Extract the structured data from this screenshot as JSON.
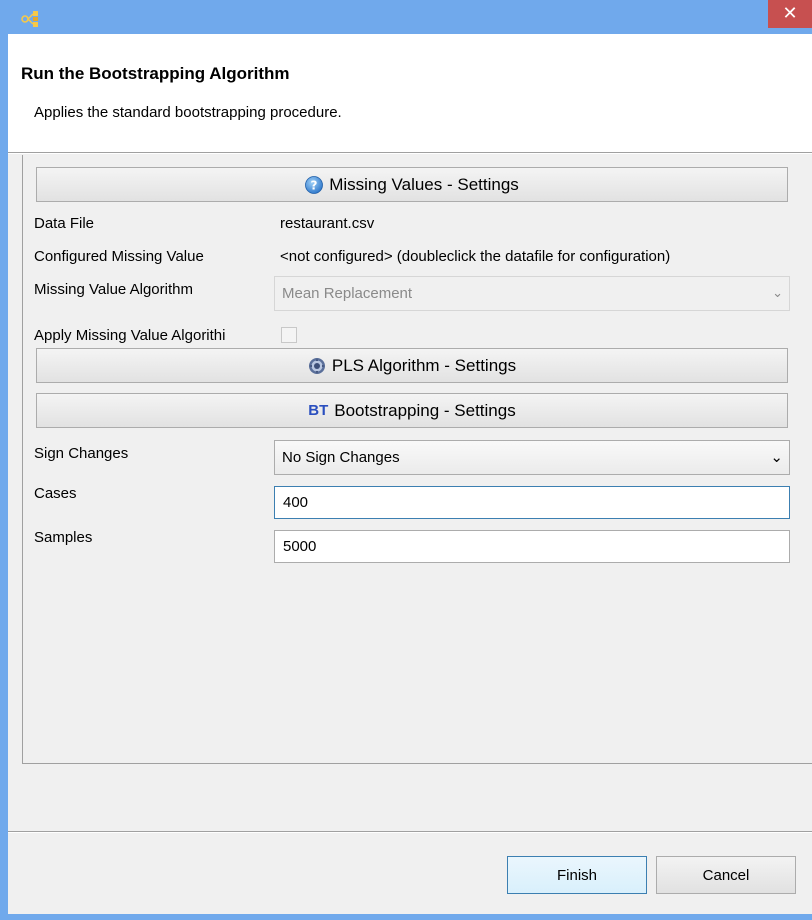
{
  "window": {
    "close_glyph": "✕",
    "colors": {
      "titlebar": "#70a9ec",
      "close": "#c75050"
    }
  },
  "header": {
    "title": "Run the Bootstrapping Algorithm",
    "description": "Applies the standard bootstrapping procedure."
  },
  "missing_values": {
    "section_label": "Missing Values - Settings",
    "icon": "help-icon",
    "data_file_label": "Data File",
    "data_file_value": "restaurant.csv",
    "configured_label": "Configured Missing Value",
    "configured_value": "<not configured> (doubleclick the datafile for configuration)",
    "algorithm_label": "Missing Value Algorithm",
    "algorithm_value": "Mean Replacement",
    "apply_label": "Apply Missing Value Algorithi",
    "apply_checked": false
  },
  "pls": {
    "section_label": "PLS Algorithm - Settings",
    "icon": "gear-icon"
  },
  "bootstrapping": {
    "section_icon_text": "BT",
    "section_label": "Bootstrapping - Settings",
    "sign_changes_label": "Sign Changes",
    "sign_changes_value": "No Sign Changes",
    "cases_label": "Cases",
    "cases_value": "400",
    "samples_label": "Samples",
    "samples_value": "5000"
  },
  "buttons": {
    "finish": "Finish",
    "cancel": "Cancel"
  }
}
